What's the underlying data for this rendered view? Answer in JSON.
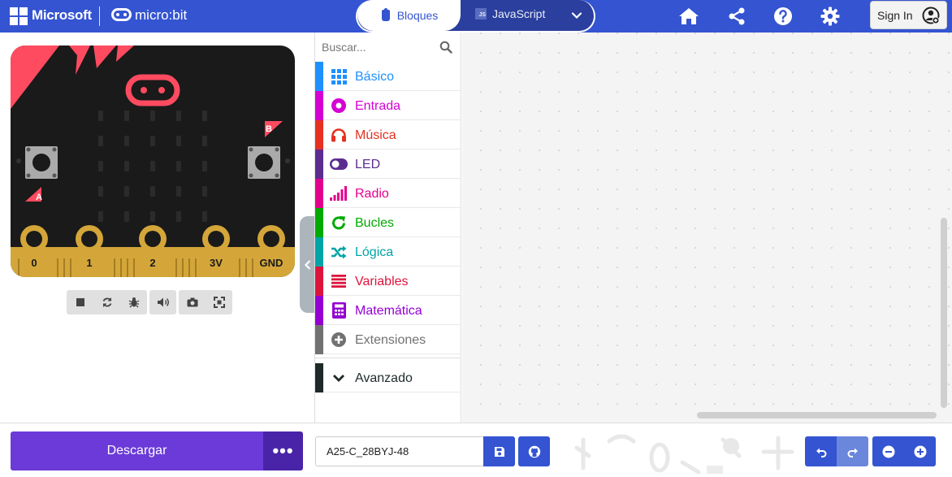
{
  "header": {
    "brand": "Microsoft",
    "product": "micro:bit",
    "tabs": [
      {
        "label": "Bloques",
        "active": true
      },
      {
        "label": "JavaScript",
        "active": false
      }
    ],
    "js_badge": "JS",
    "sign_in": "Sign In",
    "icons": [
      "home-icon",
      "share-icon",
      "help-icon",
      "settings-icon",
      "user-icon"
    ],
    "accent_color": "#3454d1"
  },
  "simulator": {
    "buttons": {
      "a": "A",
      "b": "B"
    },
    "pins": [
      "0",
      "1",
      "2",
      "3V",
      "GND"
    ],
    "controls": [
      "stop-icon",
      "restart-icon",
      "debug-icon",
      "sound-icon",
      "screenshot-icon",
      "fullscreen-icon"
    ],
    "board_color": "#1a1a1a",
    "accent_color": "#ff4b60"
  },
  "toolbox": {
    "search_placeholder": "Buscar...",
    "categories": [
      {
        "label": "Básico",
        "color": "#1e90ff",
        "icon": "grid-icon"
      },
      {
        "label": "Entrada",
        "color": "#d400d4",
        "icon": "circle-dot-icon"
      },
      {
        "label": "Música",
        "color": "#e63022",
        "icon": "headphones-icon"
      },
      {
        "label": "LED",
        "color": "#5c2d91",
        "icon": "toggle-icon"
      },
      {
        "label": "Radio",
        "color": "#e3008c",
        "icon": "signal-icon"
      },
      {
        "label": "Bucles",
        "color": "#00aa00",
        "icon": "refresh-icon"
      },
      {
        "label": "Lógica",
        "color": "#00a4a6",
        "icon": "shuffle-icon"
      },
      {
        "label": "Variables",
        "color": "#dc143c",
        "icon": "list-icon"
      },
      {
        "label": "Matemática",
        "color": "#9400d3",
        "icon": "calculator-icon"
      },
      {
        "label": "Extensiones",
        "color": "#717171",
        "icon": "plus-circle-icon"
      }
    ],
    "advanced": {
      "label": "Avanzado",
      "color": "#1e2a2a",
      "icon": "chevron-down-icon"
    }
  },
  "bottombar": {
    "download_label": "Descargar",
    "more_label": "•••",
    "project_name": "A25-C_28BYJ-48"
  }
}
